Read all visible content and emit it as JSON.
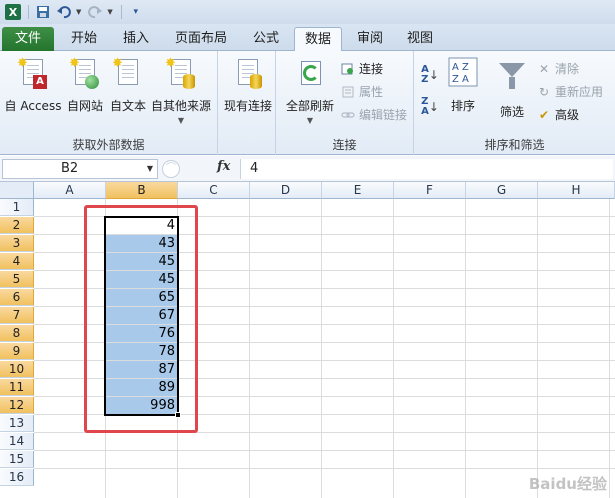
{
  "quick_access": {
    "app_icon": "X",
    "items": [
      "excel-icon",
      "save-icon",
      "undo-icon",
      "redo-icon",
      "customize-icon"
    ]
  },
  "tabs": [
    "文件",
    "开始",
    "插入",
    "页面布局",
    "公式",
    "数据",
    "审阅",
    "视图"
  ],
  "active_tab": "数据",
  "ribbon": {
    "get_external": {
      "label": "获取外部数据",
      "access": "自 Access",
      "web": "自网站",
      "text": "自文本",
      "other": "自其他来源"
    },
    "existing_connections": "现有连接",
    "connections": {
      "label": "连接",
      "refresh_all": "全部刷新",
      "connections": "连接",
      "properties": "属性",
      "edit_links": "编辑链接"
    },
    "sort_filter": {
      "label": "排序和筛选",
      "sort": "排序",
      "filter": "筛选",
      "clear": "清除",
      "reapply": "重新应用",
      "advanced": "高级"
    }
  },
  "formula_bar": {
    "name_box": "B2",
    "fx": "fx",
    "value": "4"
  },
  "grid": {
    "columns": [
      "A",
      "B",
      "C",
      "D",
      "E",
      "F",
      "G",
      "H"
    ],
    "selected_column": "B",
    "rows": [
      "1",
      "2",
      "3",
      "4",
      "5",
      "6",
      "7",
      "8",
      "9",
      "10",
      "11",
      "12",
      "13",
      "14",
      "15",
      "16"
    ],
    "selected_rows": [
      "2",
      "3",
      "4",
      "5",
      "6",
      "7",
      "8",
      "9",
      "10",
      "11",
      "12"
    ],
    "b_values": [
      "4",
      "43",
      "45",
      "45",
      "65",
      "67",
      "76",
      "78",
      "87",
      "89",
      "998"
    ]
  },
  "colors": {
    "selection_fill": "#a9c9ea",
    "annotation": "#e0474c",
    "file_tab": "#2a7a32"
  },
  "watermark": "Baidu经验"
}
